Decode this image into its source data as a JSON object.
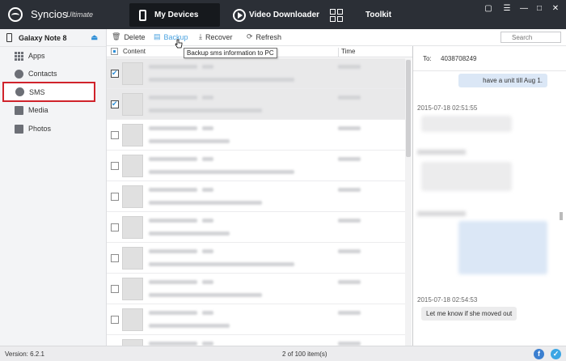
{
  "app": {
    "name": "Syncios",
    "edition": "Ultimate"
  },
  "nav": {
    "tabs": [
      {
        "label": "My Devices",
        "icon": "phone-icon",
        "active": true
      },
      {
        "label": "Video Downloader",
        "icon": "play-icon",
        "active": false
      },
      {
        "label": "Toolkit",
        "icon": "grid-icon",
        "active": false
      }
    ],
    "window_controls": [
      "chat-icon",
      "menu-icon",
      "minimize-icon",
      "maximize-icon",
      "close-icon"
    ]
  },
  "sidebar": {
    "device": "Galaxy Note 8",
    "items": [
      {
        "label": "Apps",
        "icon": "apps-icon"
      },
      {
        "label": "Contacts",
        "icon": "contacts-icon"
      },
      {
        "label": "SMS",
        "icon": "sms-icon",
        "active": true
      },
      {
        "label": "Media",
        "icon": "media-icon"
      },
      {
        "label": "Photos",
        "icon": "photos-icon"
      }
    ]
  },
  "toolbar": {
    "delete": "Delete",
    "backup": "Backup",
    "recover": "Recover",
    "refresh": "Refresh",
    "search_placeholder": "Search",
    "tooltip": "Backup sms information to PC"
  },
  "table": {
    "columns": {
      "content": "Content",
      "time": "Time"
    },
    "rows": [
      {
        "checked": true
      },
      {
        "checked": true
      },
      {
        "checked": false
      },
      {
        "checked": false
      },
      {
        "checked": false
      },
      {
        "checked": false
      },
      {
        "checked": false
      },
      {
        "checked": false
      },
      {
        "checked": false
      },
      {
        "checked": false
      }
    ]
  },
  "conversation": {
    "to_label": "To:",
    "to_number": "4038708249",
    "messages": [
      {
        "dir": "out",
        "text": "have a unit till Aug 1."
      },
      {
        "stamp": "2015-07-18 02:51:55"
      },
      {
        "stamp": "2015-07-18 02:54:53"
      },
      {
        "dir": "in",
        "text": "Let me know if she moved out"
      }
    ]
  },
  "status": {
    "version": "Version: 6.2.1",
    "count": "2 of 100 item(s)"
  },
  "colors": {
    "titlebar": "#2b2f36",
    "accent": "#2e8fd7",
    "highlight": "#d0232b"
  }
}
